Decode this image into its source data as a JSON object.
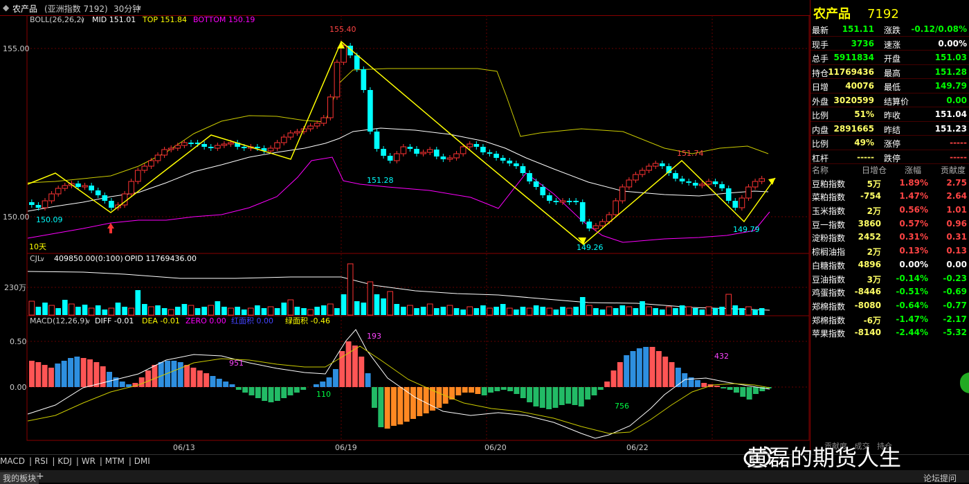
{
  "header": {
    "title": "农产品",
    "subtitle": "(亚洲指数 7192)",
    "period": "30分钟"
  },
  "boll": {
    "label": "BOLL(26,26,2)",
    "mid": "MID 151.01",
    "top": "TOP 151.84",
    "bottom": "BOTTOM 150.19"
  },
  "price_axis": {
    "high": "155.00",
    "low": "150.00"
  },
  "annotations": {
    "a1": "155.40",
    "a2": "151.28",
    "a3": "150.09",
    "a4": "149.26",
    "a5": "151.74",
    "a6": "149.79",
    "tenday": "10天"
  },
  "vol": {
    "label": "CJL",
    "value": "409850.00(0:100)",
    "opid": "OPID 11769436.00",
    "axis": "230万"
  },
  "macd": {
    "label": "MACD(12,26,9)",
    "diff": "DIFF -0.01",
    "dea": "DEA -0.01",
    "zero": "ZERO 0.00",
    "red": "红面积 0.00",
    "green": "绿面积 -0.46",
    "axis_hi": "0.50",
    "axis_zero": "0.00",
    "n1": "951",
    "n2": "193",
    "n3": "110",
    "n4": "756",
    "n5": "432"
  },
  "dates": [
    "06/13",
    "06/19",
    "06/20",
    "06/22"
  ],
  "indicator_tabs": [
    "MACD",
    "RSI",
    "KDJ",
    "WR",
    "MTM",
    "DMI"
  ],
  "bottom_tab": "我的板块",
  "bottom_plus": "+",
  "right_panel": {
    "name": "农产品",
    "code": "7192",
    "quotes": [
      {
        "l": "最新",
        "v": "151.11",
        "l2": "涨跌",
        "v2": "-0.12/0.08%"
      },
      {
        "l": "现手",
        "v": "3736",
        "l2": "速涨",
        "v2": "0.00%"
      },
      {
        "l": "总手",
        "v": "5911834",
        "l2": "开盘",
        "v2": "151.03"
      },
      {
        "l": "持仓",
        "v": "11769436",
        "l2": "最高",
        "v2": "151.28"
      },
      {
        "l": "日增",
        "v": "40076",
        "l2": "最低",
        "v2": "149.79"
      },
      {
        "l": "外盘",
        "v": "3020599",
        "l2": "结算价",
        "v2": "0.00"
      },
      {
        "l": "比例",
        "v": "51%",
        "l2": "昨收",
        "v2": "151.04"
      },
      {
        "l": "内盘",
        "v": "2891665",
        "l2": "昨结",
        "v2": "151.23"
      },
      {
        "l": "比例",
        "v": "49%",
        "l2": "涨停",
        "v2": "-----"
      },
      {
        "l": "杠杆",
        "v": "-----",
        "l2": "跌停",
        "v2": "-----"
      }
    ],
    "list_header": [
      "名称",
      "日增仓",
      "涨幅",
      "贡献度"
    ],
    "list": [
      {
        "n": "豆粕指数",
        "a": "5万",
        "b": "1.89%",
        "c": "2.75"
      },
      {
        "n": "菜粕指数",
        "a": "-754",
        "b": "1.47%",
        "c": "2.64"
      },
      {
        "n": "玉米指数",
        "a": "2万",
        "b": "0.56%",
        "c": "1.01"
      },
      {
        "n": "豆一指数",
        "a": "3860",
        "b": "0.57%",
        "c": "0.96"
      },
      {
        "n": "淀粉指数",
        "a": "2452",
        "b": "0.31%",
        "c": "0.31"
      },
      {
        "n": "棕榈油指",
        "a": "2万",
        "b": "0.13%",
        "c": "0.13"
      },
      {
        "n": "白糖指数",
        "a": "4896",
        "b": "0.00%",
        "c": "0.00"
      },
      {
        "n": "豆油指数",
        "a": "3万",
        "b": "-0.14%",
        "c": "-0.23"
      },
      {
        "n": "鸡蛋指数",
        "a": "-8446",
        "b": "-0.51%",
        "c": "-0.69"
      },
      {
        "n": "郑棉指数",
        "a": "-8080",
        "b": "-0.64%",
        "c": "-0.77"
      },
      {
        "n": "郑棉指数",
        "a": "-6万",
        "b": "-1.47%",
        "c": "-2.17"
      },
      {
        "n": "苹果指数",
        "a": "-8140",
        "b": "-2.44%",
        "c": "-5.32"
      }
    ],
    "subtabs": [
      "贡献度",
      "成交",
      "持仓"
    ],
    "forum_btn": "论坛提问"
  },
  "watermark": "黄磊的期货人生",
  "colors": {
    "up": "#ff4444",
    "down": "#00ffff",
    "gold": "#ffff00",
    "magenta": "#ff00ff",
    "green": "#00ff00",
    "white": "#ffffff"
  }
}
